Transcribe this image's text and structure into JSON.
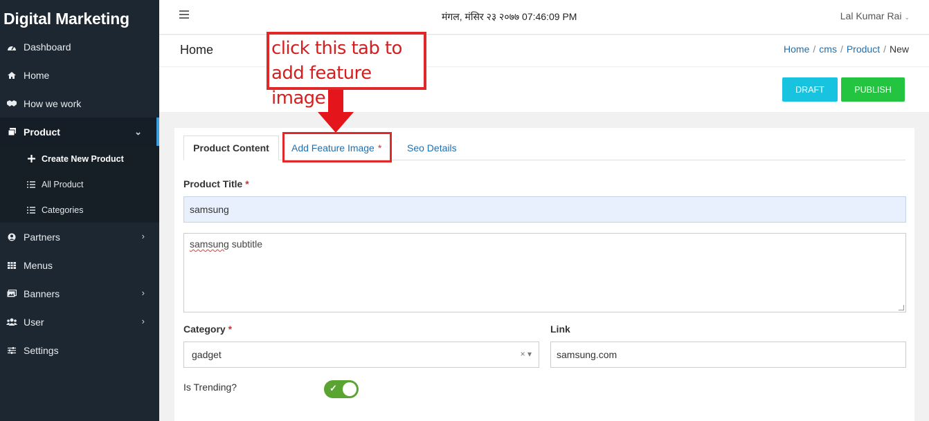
{
  "sidebar": {
    "brand": "Digital Marketing",
    "items": [
      {
        "label": "Dashboard",
        "icon": "dashboard-icon"
      },
      {
        "label": "Home",
        "icon": "home-icon"
      },
      {
        "label": "How we work",
        "icon": "handshake-icon"
      },
      {
        "label": "Product",
        "icon": "product-icon"
      },
      {
        "label": "Partners",
        "icon": "user-circle-icon"
      },
      {
        "label": "Menus",
        "icon": "grid-icon"
      },
      {
        "label": "Banners",
        "icon": "image-icon"
      },
      {
        "label": "User",
        "icon": "users-icon"
      },
      {
        "label": "Settings",
        "icon": "sliders-icon"
      }
    ],
    "sub_items": [
      {
        "label": "Create New Product",
        "icon": "plus-icon"
      },
      {
        "label": "All Product",
        "icon": "list-icon"
      },
      {
        "label": "Categories",
        "icon": "list-icon"
      }
    ]
  },
  "topbar": {
    "datetime": "मंगल, मंसिर २३ २०७७ 07:46:09 PM",
    "user": "Lal Kumar Rai"
  },
  "page": {
    "title": "Home",
    "breadcrumb": [
      "Home",
      "cms",
      "Product",
      "New"
    ]
  },
  "actions": {
    "draft": "DRAFT",
    "publish": "PUBLISH"
  },
  "colors": {
    "sidebar": "#1d2731",
    "accent": "#3c9fe0",
    "draft": "#17c3de",
    "publish": "#23c43f",
    "annotation": "#e02828"
  },
  "tabs": {
    "content": "Product Content",
    "feature": "Add Feature Image",
    "feature_req": "*",
    "seo": "Seo Details"
  },
  "form": {
    "title_label": "Product Title",
    "required": "*",
    "title_value": "samsung",
    "subtitle_word1": "samsung",
    "subtitle_word2": " subtitle",
    "category_label": "Category",
    "category_value": "gadget",
    "link_label": "Link",
    "link_value": "samsung.com",
    "trending_label": "Is Trending?",
    "trending_on": true
  },
  "annotation": {
    "line1": "click this tab to",
    "line2": "add feature image"
  }
}
